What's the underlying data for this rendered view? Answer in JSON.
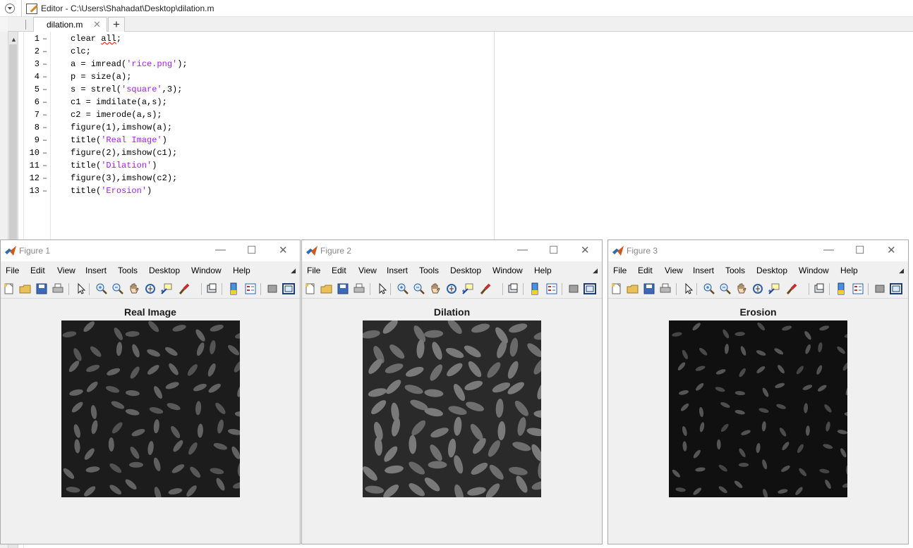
{
  "editor": {
    "title": "Editor - C:\\Users\\Shahadat\\Desktop\\dilation.m",
    "tab_label": "dilation.m",
    "tab_close": "✕",
    "add_tab": "+",
    "lines": [
      "1",
      "2",
      "3",
      "4",
      "5",
      "6",
      "7",
      "8",
      "9",
      "10",
      "11",
      "12",
      "13"
    ],
    "code": {
      "l1_a": "clear ",
      "l1_b": "all",
      "l1_c": ";",
      "l2": "clc;",
      "l3_a": "a = imread(",
      "l3_s": "'rice.png'",
      "l3_c": ");",
      "l4": "p = size(a);",
      "l5_a": "s = strel(",
      "l5_s": "'square'",
      "l5_c": ",3);",
      "l6": "c1 = imdilate(a,s);",
      "l7": "c2 = imerode(a,s);",
      "l8": "figure(1),imshow(a);",
      "l9_a": "title(",
      "l9_s": "'Real Image'",
      "l9_c": ")",
      "l10": "figure(2),imshow(c1);",
      "l11_a": "title(",
      "l11_s": "'Dilation'",
      "l11_c": ")",
      "l12": "figure(3),imshow(c2);",
      "l13_a": "title(",
      "l13_s": "'Erosion'",
      "l13_c": ")"
    },
    "dash": "–"
  },
  "menu": [
    "File",
    "Edit",
    "View",
    "Insert",
    "Tools",
    "Desktop",
    "Window",
    "Help"
  ],
  "window_buttons": {
    "minimize": "—",
    "maximize": "☐",
    "close": "✕"
  },
  "figures": [
    {
      "title": "Figure 1",
      "plot_title": "Real Image",
      "brightness": 0.3,
      "bg": "#1c1c1c",
      "grain": "#636363"
    },
    {
      "title": "Figure 2",
      "plot_title": "Dilation",
      "brightness": 0.4,
      "bg": "#2a2a2a",
      "grain": "#7a7a7a"
    },
    {
      "title": "Figure 3",
      "plot_title": "Erosion",
      "brightness": 0.2,
      "bg": "#101010",
      "grain": "#555555"
    }
  ],
  "colors": {
    "matlab_string": "#a020f0",
    "spell_squiggle": "#e0311e"
  },
  "icons": {
    "toolbar": [
      "new-figure-icon",
      "open-file-icon",
      "save-icon",
      "print-icon",
      "edit-plot-icon",
      "zoom-in-icon",
      "zoom-out-icon",
      "pan-icon",
      "rotate-3d-icon",
      "data-cursor-icon",
      "brush-icon",
      "link-plot-icon",
      "insert-colorbar-icon",
      "insert-legend-icon",
      "hide-plot-tools-icon",
      "show-plot-tools-icon"
    ]
  }
}
